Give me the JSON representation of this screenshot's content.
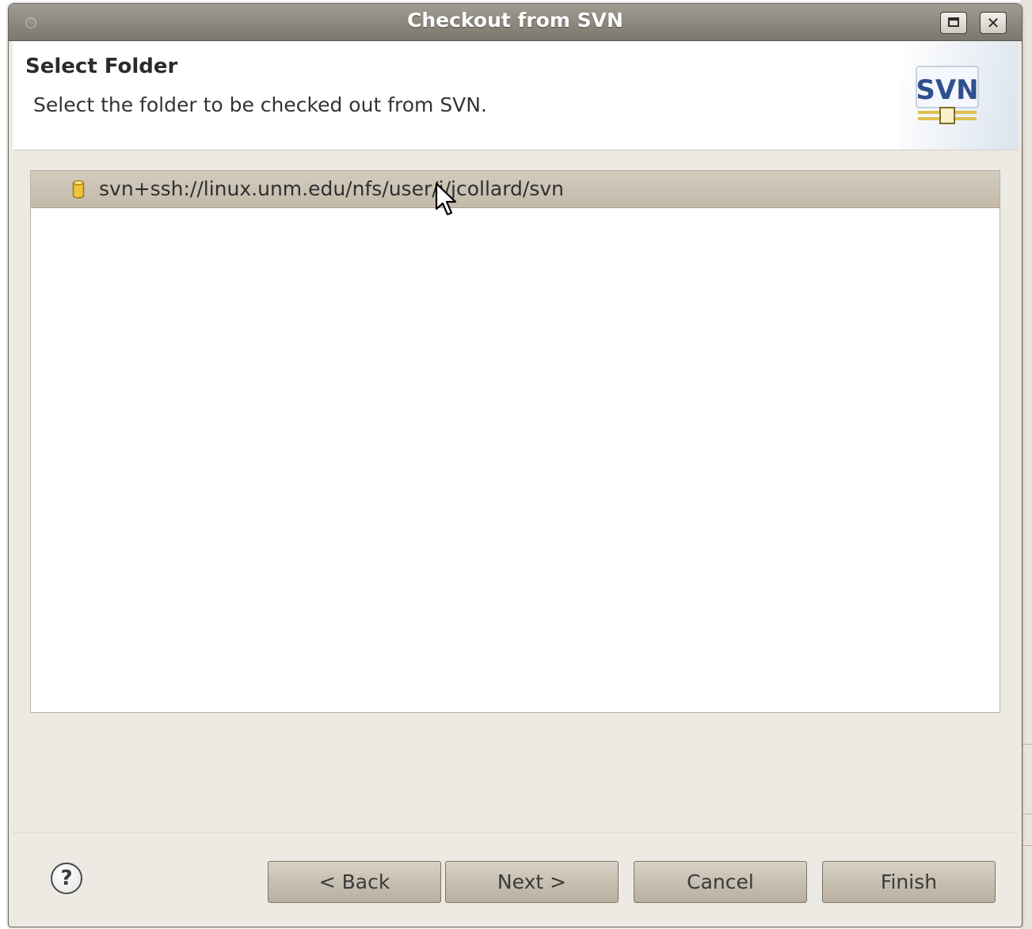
{
  "window": {
    "title": "Checkout from SVN"
  },
  "header": {
    "title": "Select Folder",
    "description": "Select the folder to be checked out from SVN.",
    "logo_text": "SVN"
  },
  "tree": {
    "items": [
      {
        "label": "svn+ssh://linux.unm.edu/nfs/user/j/jcollard/svn",
        "icon": "repository-icon",
        "selected": true
      }
    ]
  },
  "footer": {
    "help_label": "?",
    "back_label": "< Back",
    "next_label": "Next >",
    "cancel_label": "Cancel",
    "finish_label": "Finish"
  },
  "colors": {
    "titlebar": "#8c877d",
    "dialog_bg": "#edeae4",
    "selection": "#c9c1b2",
    "svn_blue": "#2f4f8f",
    "svn_gold": "#e0c050"
  }
}
